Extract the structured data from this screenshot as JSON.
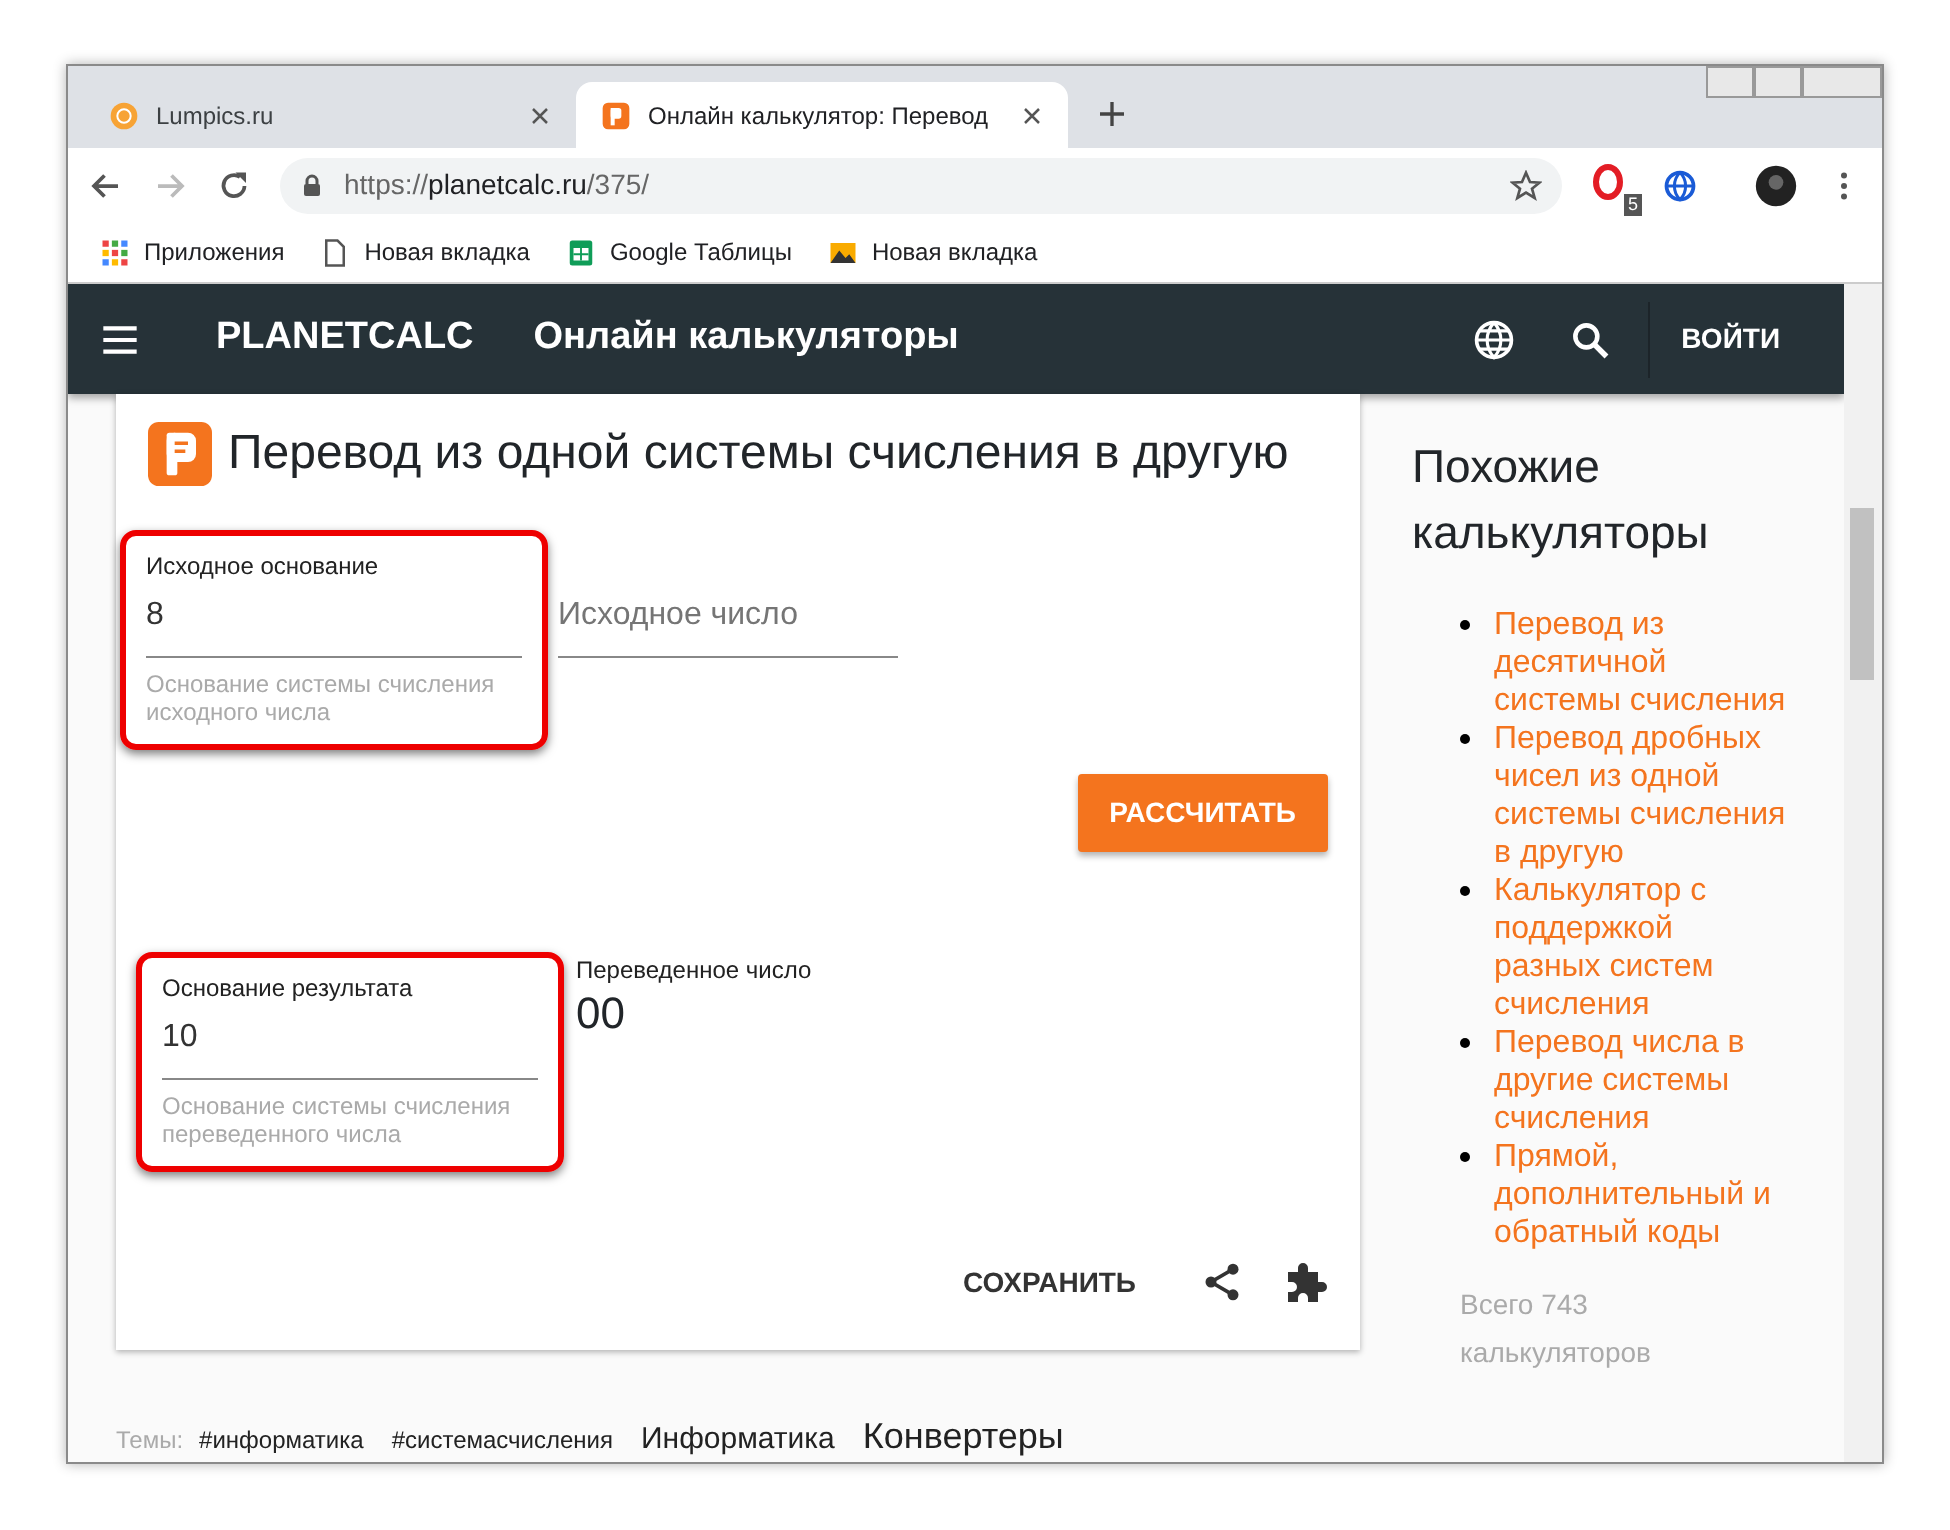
{
  "browser": {
    "tabs": [
      {
        "title": "Lumpics.ru",
        "kind": "orange",
        "selected": false
      },
      {
        "title": "Онлайн калькулятор: Перевод",
        "kind": "planetcalc",
        "selected": true
      }
    ],
    "url": {
      "scheme": "https://",
      "host": "planetcalc.ru",
      "path": "/375/"
    },
    "extension_badge": "5",
    "bookmarks": [
      {
        "label": "Приложения",
        "kind": "apps"
      },
      {
        "label": "Новая вкладка",
        "kind": "page"
      },
      {
        "label": "Google Таблицы",
        "kind": "sheets"
      },
      {
        "label": "Новая вкладка",
        "kind": "image"
      }
    ]
  },
  "navbar": {
    "brand": "PLANETCALC",
    "title": "Онлайн калькуляторы",
    "login": "ВОЙТИ"
  },
  "calculator": {
    "title": "Перевод из одной системы счисления в другую",
    "inputs": [
      {
        "label": "Исходное основание",
        "value": "8",
        "hint": "Основание системы счисления исходного числа",
        "highlighted": true
      },
      {
        "placeholder": "Исходное число",
        "highlighted": false
      }
    ],
    "button": "РАССЧИТАТЬ",
    "result_base": {
      "label": "Основание результата",
      "value": "10",
      "hint": "Основание системы счисления переведенного числа",
      "highlighted": true
    },
    "output": {
      "label": "Переведенное число",
      "value": "00"
    },
    "save": "СОХРАНИТЬ"
  },
  "topics": {
    "label": "Темы:",
    "tags": [
      {
        "text": "#информатика",
        "kind": "hashtag"
      },
      {
        "text": "#системасчисления",
        "kind": "hashtag"
      },
      {
        "text": "Информатика",
        "kind": "category"
      },
      {
        "text": "Конвертеры",
        "kind": "large"
      }
    ]
  },
  "sidebar": {
    "title": "Похожие калькуляторы",
    "links": [
      "Перевод из десятичной системы счисления",
      "Перевод дробных чисел из одной системы счисления в другую",
      "Калькулятор с поддержкой разных систем счисления",
      "Перевод числа в другие системы счисления",
      "Прямой, дополнительный и обратный коды"
    ],
    "total": "Всего 743 калькуляторов"
  }
}
